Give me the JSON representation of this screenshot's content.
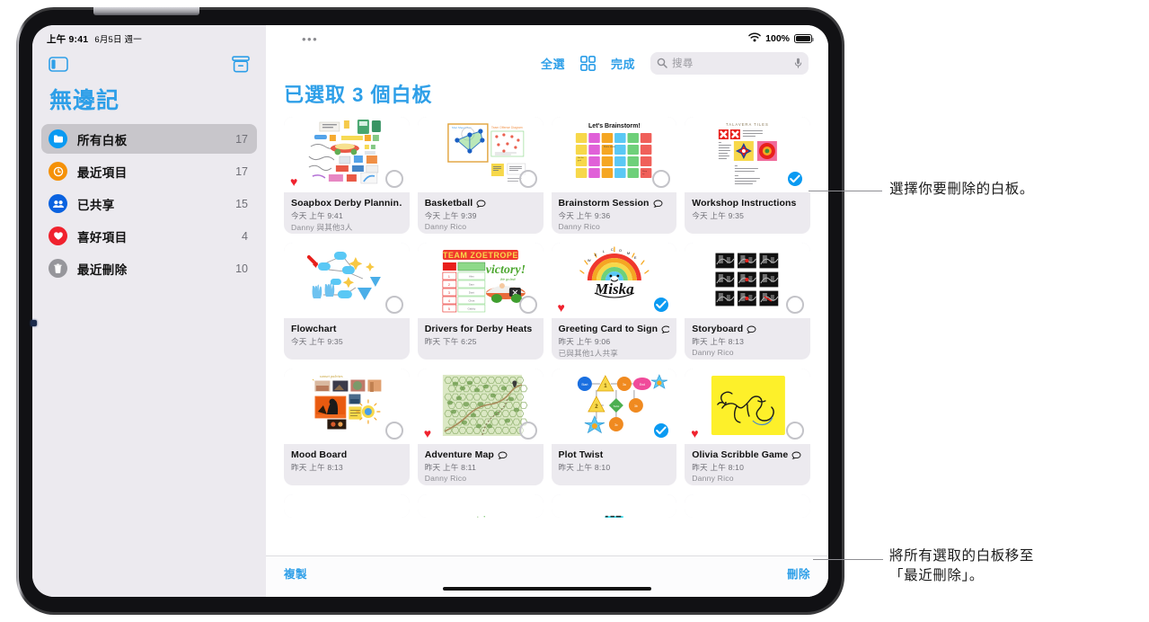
{
  "status": {
    "time": "上午 9:41",
    "date": "6月5日 週一",
    "wifi_icon": "wifi-icon",
    "battery_percent": "100%"
  },
  "sidebar": {
    "app_title": "無邊記",
    "toggle_sidebar_icon": "sidebar-toggle-icon",
    "new_board_icon": "new-board-icon",
    "items": [
      {
        "label": "所有白板",
        "count": "17",
        "icon": "all-boards-icon",
        "color": "#0a9af2",
        "selected": true
      },
      {
        "label": "最近項目",
        "count": "17",
        "icon": "recents-clock-icon",
        "color": "#f59107",
        "selected": false
      },
      {
        "label": "已共享",
        "count": "15",
        "icon": "shared-people-icon",
        "color": "#0a62e0",
        "selected": false
      },
      {
        "label": "喜好項目",
        "count": "4",
        "icon": "favorites-heart-icon",
        "color": "#f0222e",
        "selected": false
      },
      {
        "label": "最近刪除",
        "count": "10",
        "icon": "trash-icon",
        "color": "#96969b",
        "selected": false
      }
    ]
  },
  "main": {
    "more_icon": "more-dots-icon",
    "select_all_label": "全選",
    "grid_view_icon": "grid-view-icon",
    "done_label": "完成",
    "search_placeholder": "搜尋",
    "search_icon": "search-icon",
    "mic_icon": "microphone-icon",
    "page_title": "已選取 3 個白板",
    "accent_color": "#2e9fe8"
  },
  "boards": [
    {
      "title": "Soapbox Derby Plannin…",
      "time": "今天 上午 9:41",
      "owner": "Danny 與其他3人",
      "favorite": true,
      "selected": false,
      "shared_icon": false,
      "art": "soapbox"
    },
    {
      "title": "Basketball",
      "time": "今天 上午 9:39",
      "owner": "Danny Rico",
      "favorite": false,
      "selected": false,
      "shared_icon": true,
      "art": "basketball"
    },
    {
      "title": "Brainstorm Session",
      "time": "今天 上午 9:36",
      "owner": "Danny Rico",
      "favorite": false,
      "selected": false,
      "shared_icon": true,
      "art": "brainstorm"
    },
    {
      "title": "Workshop Instructions",
      "time": "今天 上午 9:35",
      "owner": "",
      "favorite": false,
      "selected": true,
      "shared_icon": false,
      "art": "workshop"
    },
    {
      "title": "Flowchart",
      "time": "今天 上午 9:35",
      "owner": "",
      "favorite": false,
      "selected": false,
      "shared_icon": false,
      "art": "flowchart"
    },
    {
      "title": "Drivers for Derby Heats",
      "time": "昨天 下午 6:25",
      "owner": "",
      "favorite": false,
      "selected": false,
      "shared_icon": false,
      "art": "derby"
    },
    {
      "title": "Greeting Card to Sign",
      "time": "昨天 上午 9:06",
      "owner": "已與其他1人共享",
      "favorite": true,
      "selected": true,
      "shared_icon": true,
      "art": "greeting"
    },
    {
      "title": "Storyboard",
      "time": "昨天 上午 8:13",
      "owner": "Danny Rico",
      "favorite": false,
      "selected": false,
      "shared_icon": true,
      "art": "storyboard"
    },
    {
      "title": "Mood Board",
      "time": "昨天 上午 8:13",
      "owner": "",
      "favorite": false,
      "selected": false,
      "shared_icon": false,
      "art": "moodboard"
    },
    {
      "title": "Adventure Map",
      "time": "昨天 上午 8:11",
      "owner": "Danny Rico",
      "favorite": true,
      "selected": false,
      "shared_icon": true,
      "art": "map"
    },
    {
      "title": "Plot Twist",
      "time": "昨天 上午 8:10",
      "owner": "",
      "favorite": false,
      "selected": true,
      "shared_icon": false,
      "art": "plot"
    },
    {
      "title": "Olivia Scribble Game",
      "time": "昨天 上午 8:10",
      "owner": "Danny Rico",
      "favorite": true,
      "selected": false,
      "shared_icon": true,
      "art": "scribble"
    }
  ],
  "bottombar": {
    "duplicate_label": "複製",
    "delete_label": "刪除"
  },
  "callouts": {
    "top": "選擇你要刪除的白板。",
    "bottom_line1": "將所有選取的白板移至",
    "bottom_line2": "「最近刪除」。"
  }
}
